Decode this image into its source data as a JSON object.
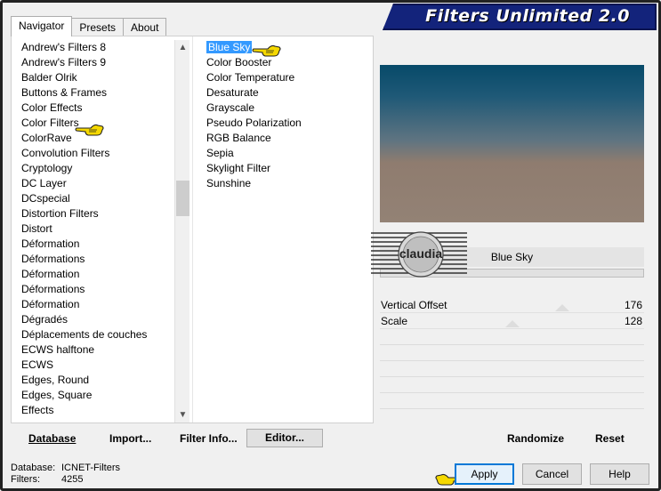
{
  "window": {
    "title": "Filters Unlimited 2.0"
  },
  "tabs": [
    {
      "label": "Navigator",
      "active": true
    },
    {
      "label": "Presets",
      "active": false
    },
    {
      "label": "About",
      "active": false
    }
  ],
  "categories": [
    "Andrew's Filters 8",
    "Andrew's Filters 9",
    "Balder Olrik",
    "Buttons & Frames",
    "Color Effects",
    "Color Filters",
    "ColorRave",
    "Convolution Filters",
    "Cryptology",
    "DC Layer",
    "DCspecial",
    "Distortion Filters",
    "Distort",
    "Déformation",
    "Déformations",
    "Déformation",
    "Déformations",
    "Déformation",
    "Dégradés",
    "Déplacements de couches",
    "ECWS halftone",
    "ECWS",
    "Edges, Round",
    "Edges, Square",
    "Effects"
  ],
  "selected_category": "Color Filters",
  "filters": [
    "Blue Sky",
    "Color Booster",
    "Color Temperature",
    "Desaturate",
    "Grayscale",
    "Pseudo Polarization",
    "RGB Balance",
    "Sepia",
    "Skylight Filter",
    "Sunshine"
  ],
  "selected_filter": "Blue Sky",
  "preview": {
    "filter_name": "Blue Sky"
  },
  "watermark": {
    "text": "claudia"
  },
  "parameters": [
    {
      "label": "Vertical Offset",
      "value": "176"
    },
    {
      "label": "Scale",
      "value": "128"
    }
  ],
  "left_buttons": {
    "database": "Database",
    "import": "Import...",
    "filter_info": "Filter Info...",
    "editor": "Editor..."
  },
  "right_buttons": {
    "randomize": "Randomize",
    "reset": "Reset"
  },
  "status": {
    "database_label": "Database:",
    "database_value": "ICNET-Filters",
    "filters_label": "Filters:",
    "filters_value": "4255"
  },
  "dialog_buttons": {
    "apply": "Apply",
    "cancel": "Cancel",
    "help": "Help"
  },
  "colors": {
    "banner": "#13237b",
    "selection": "#3399ff",
    "pointer_hand": "#f5d800"
  }
}
